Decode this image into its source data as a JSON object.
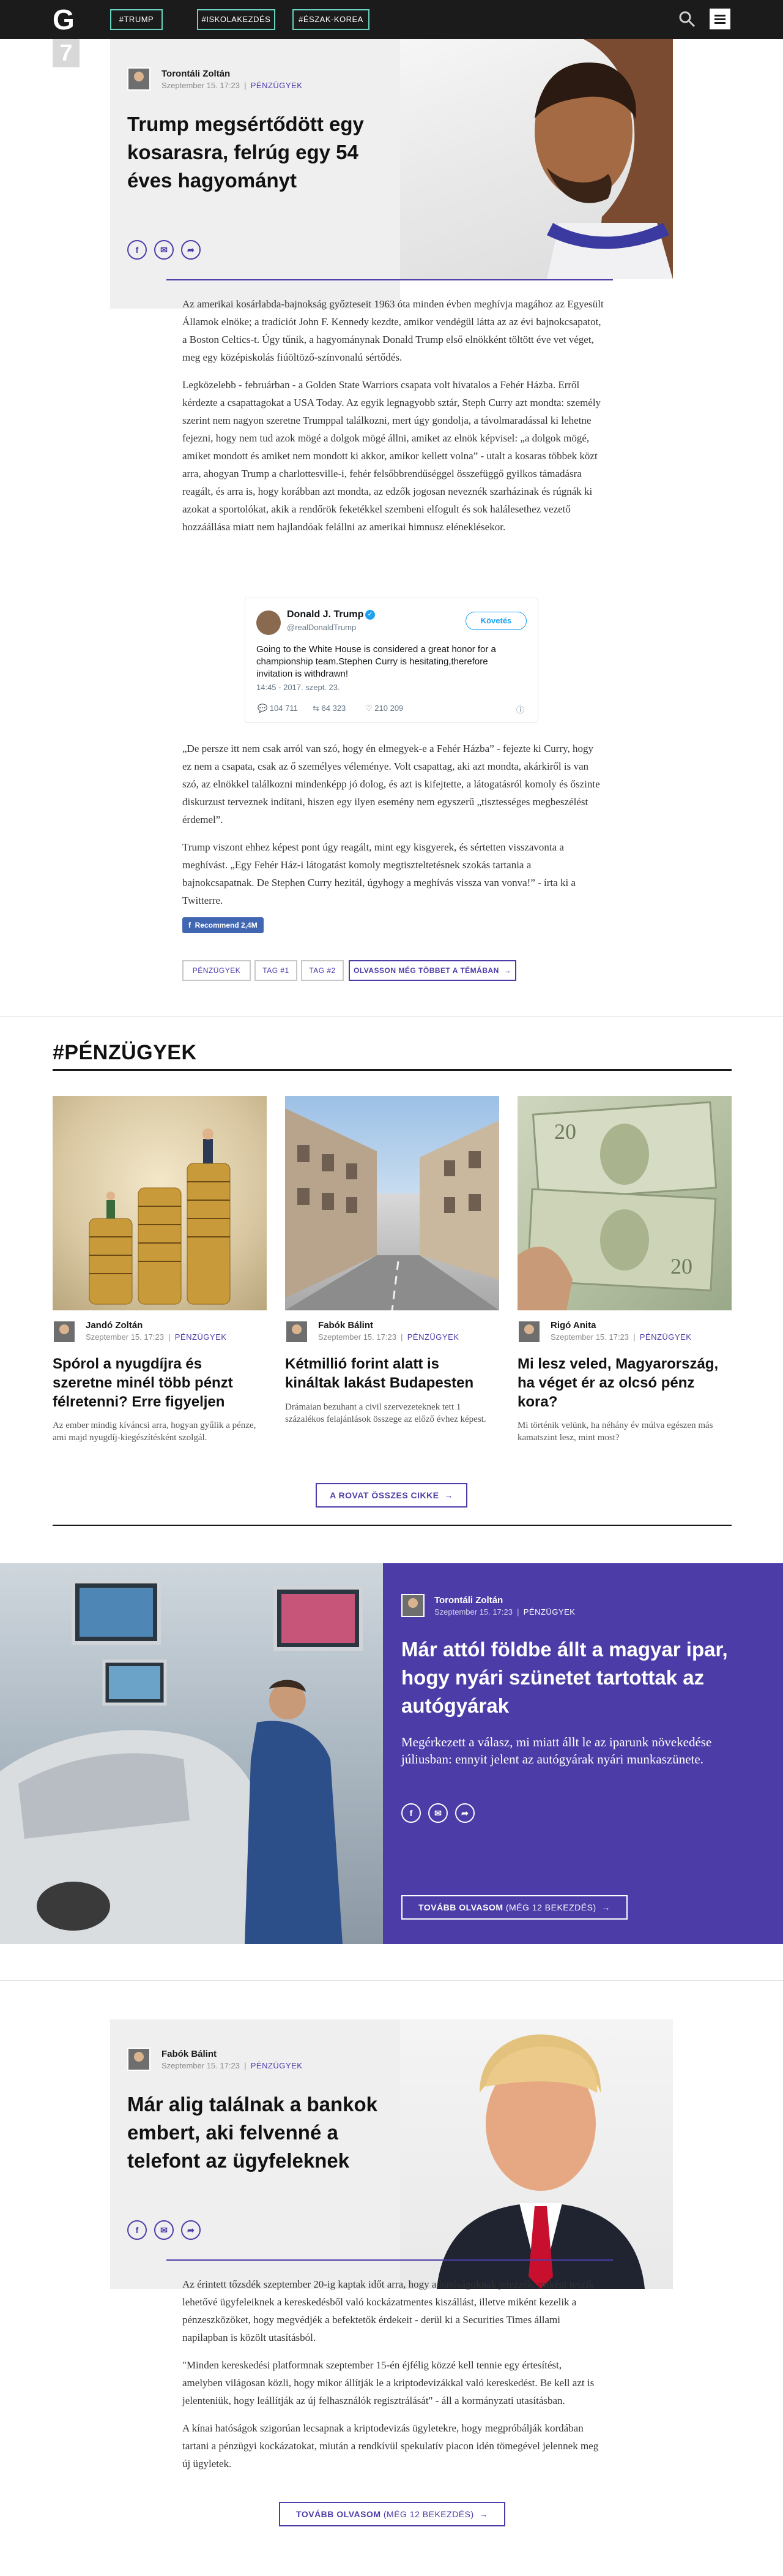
{
  "topbar": {
    "logo": "G",
    "tags": [
      "#TRUMP",
      "#ISKOLAKEZDÉS",
      "#ÉSZAK-KOREA"
    ]
  },
  "article1": {
    "rank": "7",
    "author": "Torontáli Zoltán",
    "date": "Szeptember 15. 17:23",
    "category": "PÉNZÜGYEK",
    "title": "Trump megsértődött egy kosarasra, felrúg egy 54 éves hagyományt",
    "paragraphs": [
      "Az amerikai kosárlabda-bajnokság győzteseit 1963 óta minden évben meghívja magához az Egyesült Államok elnöke; a tradíciót John F. Kennedy kezdte, amikor vendégül látta az az évi bajnokcsapatot, a Boston Celtics-t. Úgy tűnik, a hagyománynak Donald Trump első elnökként töltött éve vet véget, meg egy középiskolás fiúöltöző-színvonalú sértődés.",
      "Legközelebb - februárban - a Golden State Warriors csapata volt hivatalos a Fehér Házba. Erről kérdezte a csapattagokat a USA Today. Az egyik legnagyobb sztár, Steph Curry azt mondta: személy szerint nem nagyon szeretne Trumppal találkozni, mert úgy gondolja, a távolmaradással ki lehetne fejezni, hogy nem tud azok mögé a dolgok mögé állni, amiket az elnök képvisel: „a dolgok mögé, amiket mondott és amiket nem mondott ki akkor, amikor kellett volna” - utalt a kosaras többek közt arra, ahogyan Trump a charlottesville-i, fehér felsőbbrendűséggel összefüggő gyilkos támadásra reagált, és arra is, hogy korábban azt mondta, az edzők jogosan neveznék szarházinak és rúgnák ki azokat a sportolókat, akik a rendőrök feketékkel szembeni elfogult és sok halálesethez vezető hozzáállása miatt nem hajlandóak felállni az amerikai himnusz eléneklésekor."
    ],
    "paragraphs2": [
      "„De persze itt nem csak arról van szó, hogy én elmegyek-e a Fehér Házba” - fejezte ki Curry, hogy ez nem a csapata, csak az ő személyes véleménye. Volt csapattag, aki azt mondta, akárkiről is van szó, az elnökkel találkozni mindenképp jó dolog, és azt is kifejtette, a látogatásról komoly és őszinte diskurzust terveznek indítani, hiszen egy ilyen esemény nem egyszerű „tisztességes megbeszélést érdemel”.",
      "Trump viszont ehhez képest pont úgy reagált, mint egy kisgyerek, és sértetten visszavonta a meghívást. „Egy Fehér Ház-i látogatást komoly megtiszteltetésnek szokás tartania a bajnokcsapatnak. De Stephen Curry hezitál, úgyhogy a meghívás vissza van vonva!” - írta ki a Twitterre."
    ],
    "tweet": {
      "name": "Donald J. Trump",
      "handle": "@realDonaldTrump",
      "follow": "Követés",
      "text": "Going to the White House is considered a great honor for a championship team.Stephen Curry is hesitating,therefore invitation is withdrawn!",
      "time": "14:45 - 2017. szept. 23.",
      "replies": "104 711",
      "retweets": "64 323",
      "likes": "210 209",
      "info": "ⓘ"
    },
    "recommend": "Recommend 2,4M",
    "tags": [
      "PÉNZÜGYEK",
      "TAG #1",
      "TAG #2"
    ],
    "more_button": "OLVASSON MÉG TÖBBET A TÉMÁBAN"
  },
  "section": {
    "title": "#PÉNZÜGYEK",
    "cards": [
      {
        "author": "Jandó Zoltán",
        "date": "Szeptember 15. 17:23",
        "category": "PÉNZÜGYEK",
        "title": "Spórol a nyugdíjra és szeretne minél több pénzt félretenni? Erre figyeljen",
        "text": "Az ember mindig kíváncsi arra, hogyan gyűlik a pénze, ami majd nyugdíj-kiegészítésként szolgál."
      },
      {
        "author": "Fabók Bálint",
        "date": "Szeptember 15. 17:23",
        "category": "PÉNZÜGYEK",
        "title": "Kétmillió forint alatt is kináltak lakást Budapesten",
        "text": "Drámaian bezuhant a civil szervezeteknek tett 1 százalékos felajánlások összege az előző évhez képest."
      },
      {
        "author": "Rigó Anita",
        "date": "Szeptember 15. 17:23",
        "category": "PÉNZÜGYEK",
        "title": "Mi lesz veled, Magyarország, ha véget ér az olcsó pénz kora?",
        "text": "Mi történik velünk, ha néhány év múlva egészen más kamatszint lesz, mint most?"
      }
    ],
    "all_button": "A ROVAT ÖSSZES CIKKE"
  },
  "feature": {
    "author": "Torontáli Zoltán",
    "date": "Szeptember 15. 17:23",
    "category": "PÉNZÜGYEK",
    "title": "Már attól földbe állt a magyar ipar, hogy nyári szünetet tartottak az autógyárak",
    "lead": "Megérkezett a válasz, mi miatt állt le az iparunk növekedése júliusban: ennyit jelent az autógyárak nyári munkaszünete.",
    "read_more": "TOVÁBB OLVASOM",
    "read_more_count": "(MÉG 12 BEKEZDÉS)"
  },
  "article2": {
    "author": "Fabók Bálint",
    "date": "Szeptember 15. 17:23",
    "category": "PÉNZÜGYEK",
    "title": "Már alig találnak a bankok embert, aki felvenné a telefont az ügyfeleknek",
    "paragraphs": [
      "Az érintett tőzsdék szeptember 20-ig kaptak időt arra, hogy a hatóságoknak jelezzék, miként teszik lehetővé ügyfeleiknek a kereskedésből való kockázatmentes kiszállást, illetve miként kezelik a pénzeszközöket, hogy megvédjék a befektetők érdekeit - derül ki a Securities Times állami napilapban is közölt utasításból.",
      "\"Minden kereskedési platformnak szeptember 15-én éjfélig közzé kell tennie egy értesítést, amelyben világosan közli, hogy mikor állítják le a kriptodevizákkal való kereskedést. Be kell azt is jelenteniük, hogy leállítják az új felhasználók regisztrálását\" - áll a kormányzati utasításban.",
      "A kínai hatóságok szigorúan lecsapnak a kriptodevizás ügyletekre, hogy megpróbálják kordában tartani a pénzügyi kockázatokat, miután a rendkívül spekulatív piacon idén tömegével jelennek meg új ügyletek."
    ],
    "read_more": "TOVÁBB OLVASOM",
    "read_more_count": "(MÉG 12 BEKEZDÉS)"
  },
  "colors": {
    "accent": "#4b3ca8",
    "topbar": "#1b1b1b",
    "tag_border": "#6ad2c0"
  }
}
